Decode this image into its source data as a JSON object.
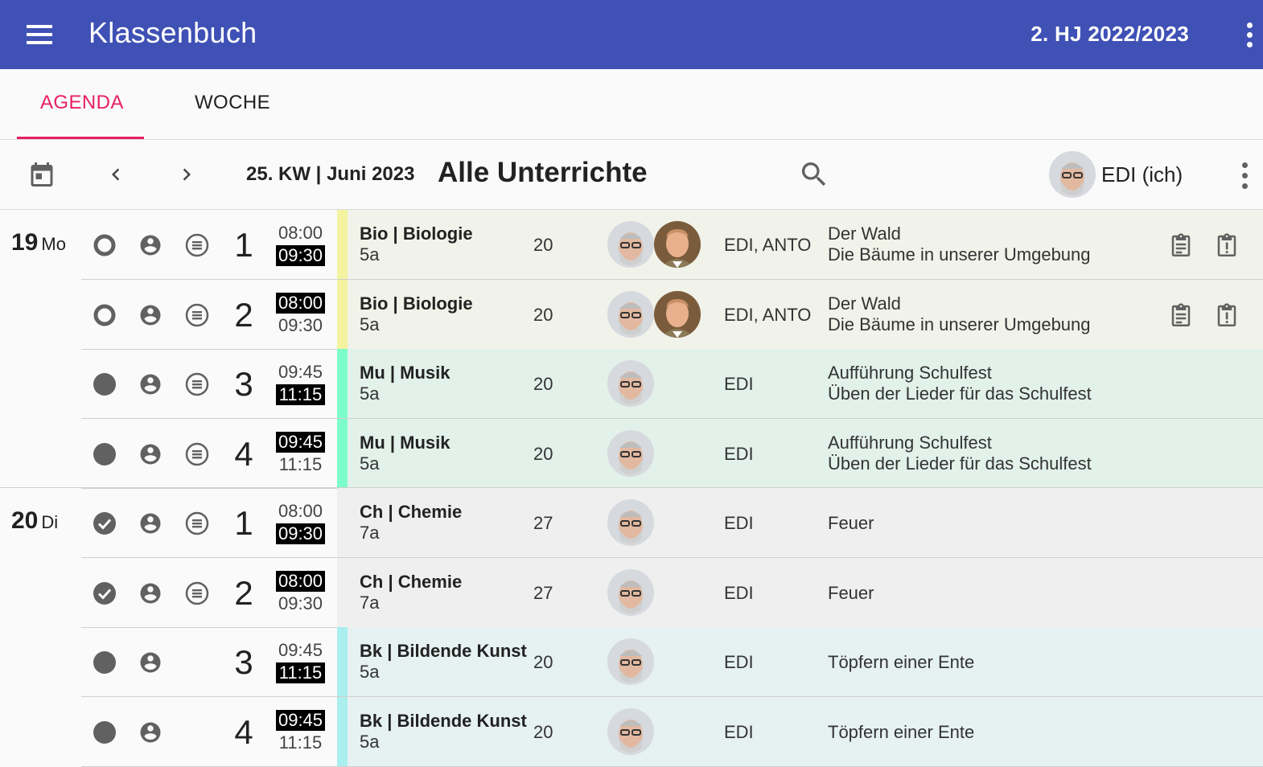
{
  "appbar": {
    "title": "Klassenbuch",
    "term": "2. HJ 2022/2023",
    "menu_icon": "menu-icon",
    "more_icon": "more-vert-icon",
    "color": "#3f51b5"
  },
  "tabs": [
    {
      "label": "AGENDA",
      "active": true
    },
    {
      "label": "WOCHE",
      "active": false
    }
  ],
  "toolbar": {
    "week": "25. KW | Juni 2023",
    "view_title": "Alle Unterrichte",
    "user_label": "EDI (ich)"
  },
  "days": [
    {
      "num": "19",
      "dow": "Mo"
    },
    {
      "num": "20",
      "dow": "Di"
    }
  ],
  "rows": [
    {
      "status": "open",
      "lesson": "1",
      "start": "08:00",
      "end": "09:30",
      "highlight": "end",
      "subject": "Bio | Biologie",
      "class": "5a",
      "count": "20",
      "teachers": "EDI, ANTO",
      "topic_title": "Der Wald",
      "topic_detail": "Die Bäume in unserer Umgebung",
      "accent": "#f3f3a0",
      "bg": "#f1f2e9"
    },
    {
      "status": "open",
      "lesson": "2",
      "start": "08:00",
      "end": "09:30",
      "highlight": "start",
      "subject": "Bio | Biologie",
      "class": "5a",
      "count": "20",
      "teachers": "EDI, ANTO",
      "topic_title": "Der Wald",
      "topic_detail": "Die Bäume in unserer Umgebung",
      "accent": "#f3f3a0",
      "bg": "#f1f2e9"
    },
    {
      "status": "pending",
      "lesson": "3",
      "start": "09:45",
      "end": "11:15",
      "highlight": "end",
      "subject": "Mu | Musik",
      "class": "5a",
      "count": "20",
      "teachers": "EDI",
      "topic_title": "Aufführung Schulfest",
      "topic_detail": "Üben der Lieder für das Schulfest",
      "accent": "#7dfcc9",
      "bg": "#e2f1ea"
    },
    {
      "status": "pending",
      "lesson": "4",
      "start": "09:45",
      "end": "11:15",
      "highlight": "start",
      "subject": "Mu | Musik",
      "class": "5a",
      "count": "20",
      "teachers": "EDI",
      "topic_title": "Aufführung Schulfest",
      "topic_detail": "Üben der Lieder für das Schulfest",
      "accent": "#7dfcc9",
      "bg": "#e2f1ea"
    },
    {
      "status": "done",
      "lesson": "1",
      "start": "08:00",
      "end": "09:30",
      "highlight": "end",
      "subject": "Ch | Chemie",
      "class": "7a",
      "count": "27",
      "teachers": "EDI",
      "topic_title": "Feuer",
      "accent": "#efefef",
      "bg": "#efefef"
    },
    {
      "status": "done",
      "lesson": "2",
      "start": "08:00",
      "end": "09:30",
      "highlight": "start",
      "subject": "Ch | Chemie",
      "class": "7a",
      "count": "27",
      "teachers": "EDI",
      "topic_title": "Feuer",
      "accent": "#efefef",
      "bg": "#efefef"
    },
    {
      "status": "pending",
      "lesson": "3",
      "start": "09:45",
      "end": "11:15",
      "highlight": "end",
      "subject": "Bk | Bildende Kunst",
      "class": "5a",
      "count": "20",
      "teachers": "EDI",
      "topic_title": "Töpfern einer Ente",
      "accent": "#aaeeee",
      "bg": "#e6f1f1"
    },
    {
      "status": "pending",
      "lesson": "4",
      "start": "09:45",
      "end": "11:15",
      "highlight": "start",
      "subject": "Bk | Bildende Kunst",
      "class": "5a",
      "count": "20",
      "teachers": "EDI",
      "topic_title": "Töpfern einer Ente",
      "accent": "#aaeeee",
      "bg": "#e6f1f1"
    }
  ]
}
